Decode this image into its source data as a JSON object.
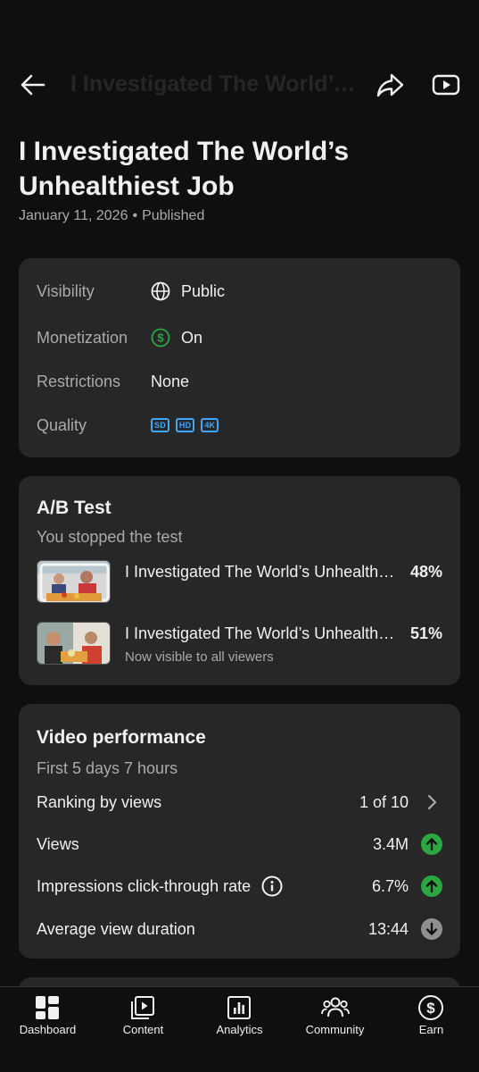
{
  "header": {
    "title": "I Investigated The World’s Unhealthiest Job",
    "back_icon": "arrow-left-icon",
    "share_icon": "share-icon",
    "youtube_icon": "youtube-play-icon"
  },
  "video": {
    "title": "I Investigated The World’s Unhealthiest Job",
    "date": "January 11, 2026",
    "separator": "•",
    "status": "Published"
  },
  "details": {
    "visibility_label": "Visibility",
    "visibility_value": "Public",
    "monetization_label": "Monetization",
    "monetization_value": "On",
    "restrictions_label": "Restrictions",
    "restrictions_value": "None",
    "quality_label": "Quality",
    "quality_badges": [
      "SD",
      "HD",
      "4K"
    ]
  },
  "ab_test": {
    "heading": "A/B Test",
    "subtitle": "You stopped the test",
    "variants": [
      {
        "title": "I Investigated The World’s Unhealthiest Job",
        "percent": "48%",
        "note": ""
      },
      {
        "title": "I Investigated The World’s Unhealthiest Job",
        "percent": "51%",
        "note": "Now visible to all viewers"
      }
    ]
  },
  "performance": {
    "heading": "Video performance",
    "subtitle": "First 5 days 7 hours",
    "ranking_label": "Ranking by views",
    "ranking_value": "1 of 10",
    "views_label": "Views",
    "views_value": "3.4M",
    "ctr_label": "Impressions click-through rate",
    "ctr_value": "6.7%",
    "avd_label": "Average view duration",
    "avd_value": "13:44"
  },
  "colors": {
    "background": "#0f0f0f",
    "card": "#272727",
    "accent_blue": "#3ea6ff",
    "up_green": "#2ba640",
    "down_gray": "#909090"
  },
  "nav": {
    "items": [
      {
        "label": "Dashboard",
        "icon": "dashboard-icon"
      },
      {
        "label": "Content",
        "icon": "content-icon"
      },
      {
        "label": "Analytics",
        "icon": "analytics-icon"
      },
      {
        "label": "Community",
        "icon": "community-icon"
      },
      {
        "label": "Earn",
        "icon": "earn-icon"
      }
    ]
  }
}
